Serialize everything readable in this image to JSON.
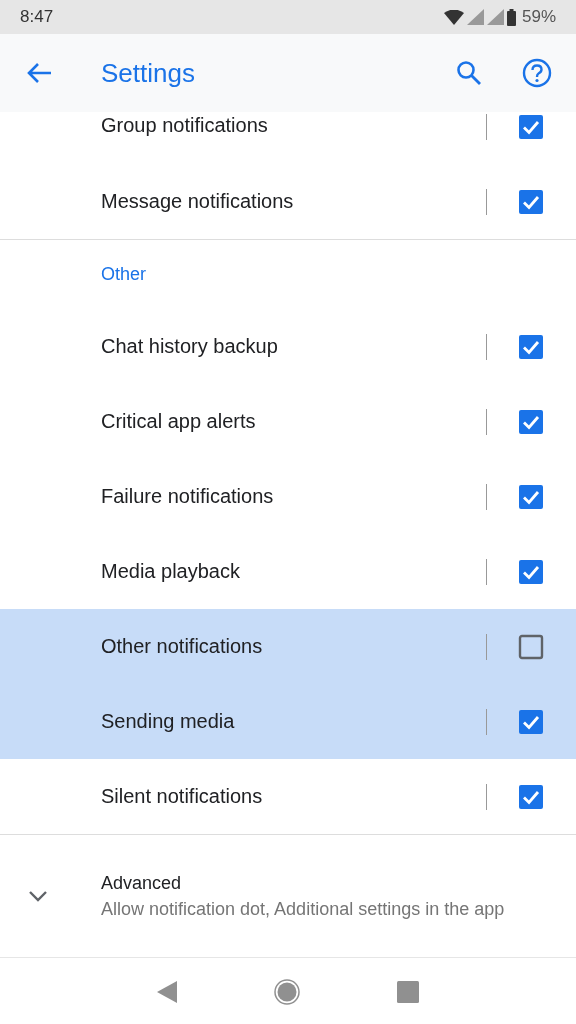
{
  "status_bar": {
    "time": "8:47",
    "battery": "59%"
  },
  "app_bar": {
    "title": "Settings"
  },
  "sections": [
    {
      "rows": [
        {
          "label": "Group notifications",
          "checked": true,
          "selected": false
        },
        {
          "label": "Message notifications",
          "checked": true,
          "selected": false
        }
      ]
    },
    {
      "header": "Other",
      "rows": [
        {
          "label": "Chat history backup",
          "checked": true,
          "selected": false
        },
        {
          "label": "Critical app alerts",
          "checked": true,
          "selected": false
        },
        {
          "label": "Failure notifications",
          "checked": true,
          "selected": false
        },
        {
          "label": "Media playback",
          "checked": true,
          "selected": false
        },
        {
          "label": "Other notifications",
          "checked": false,
          "selected": true
        },
        {
          "label": "Sending media",
          "checked": true,
          "selected": true
        },
        {
          "label": "Silent notifications",
          "checked": true,
          "selected": false
        }
      ]
    }
  ],
  "advanced": {
    "title": "Advanced",
    "summary": "Allow notification dot, Additional settings in the app",
    "expanded": false
  }
}
